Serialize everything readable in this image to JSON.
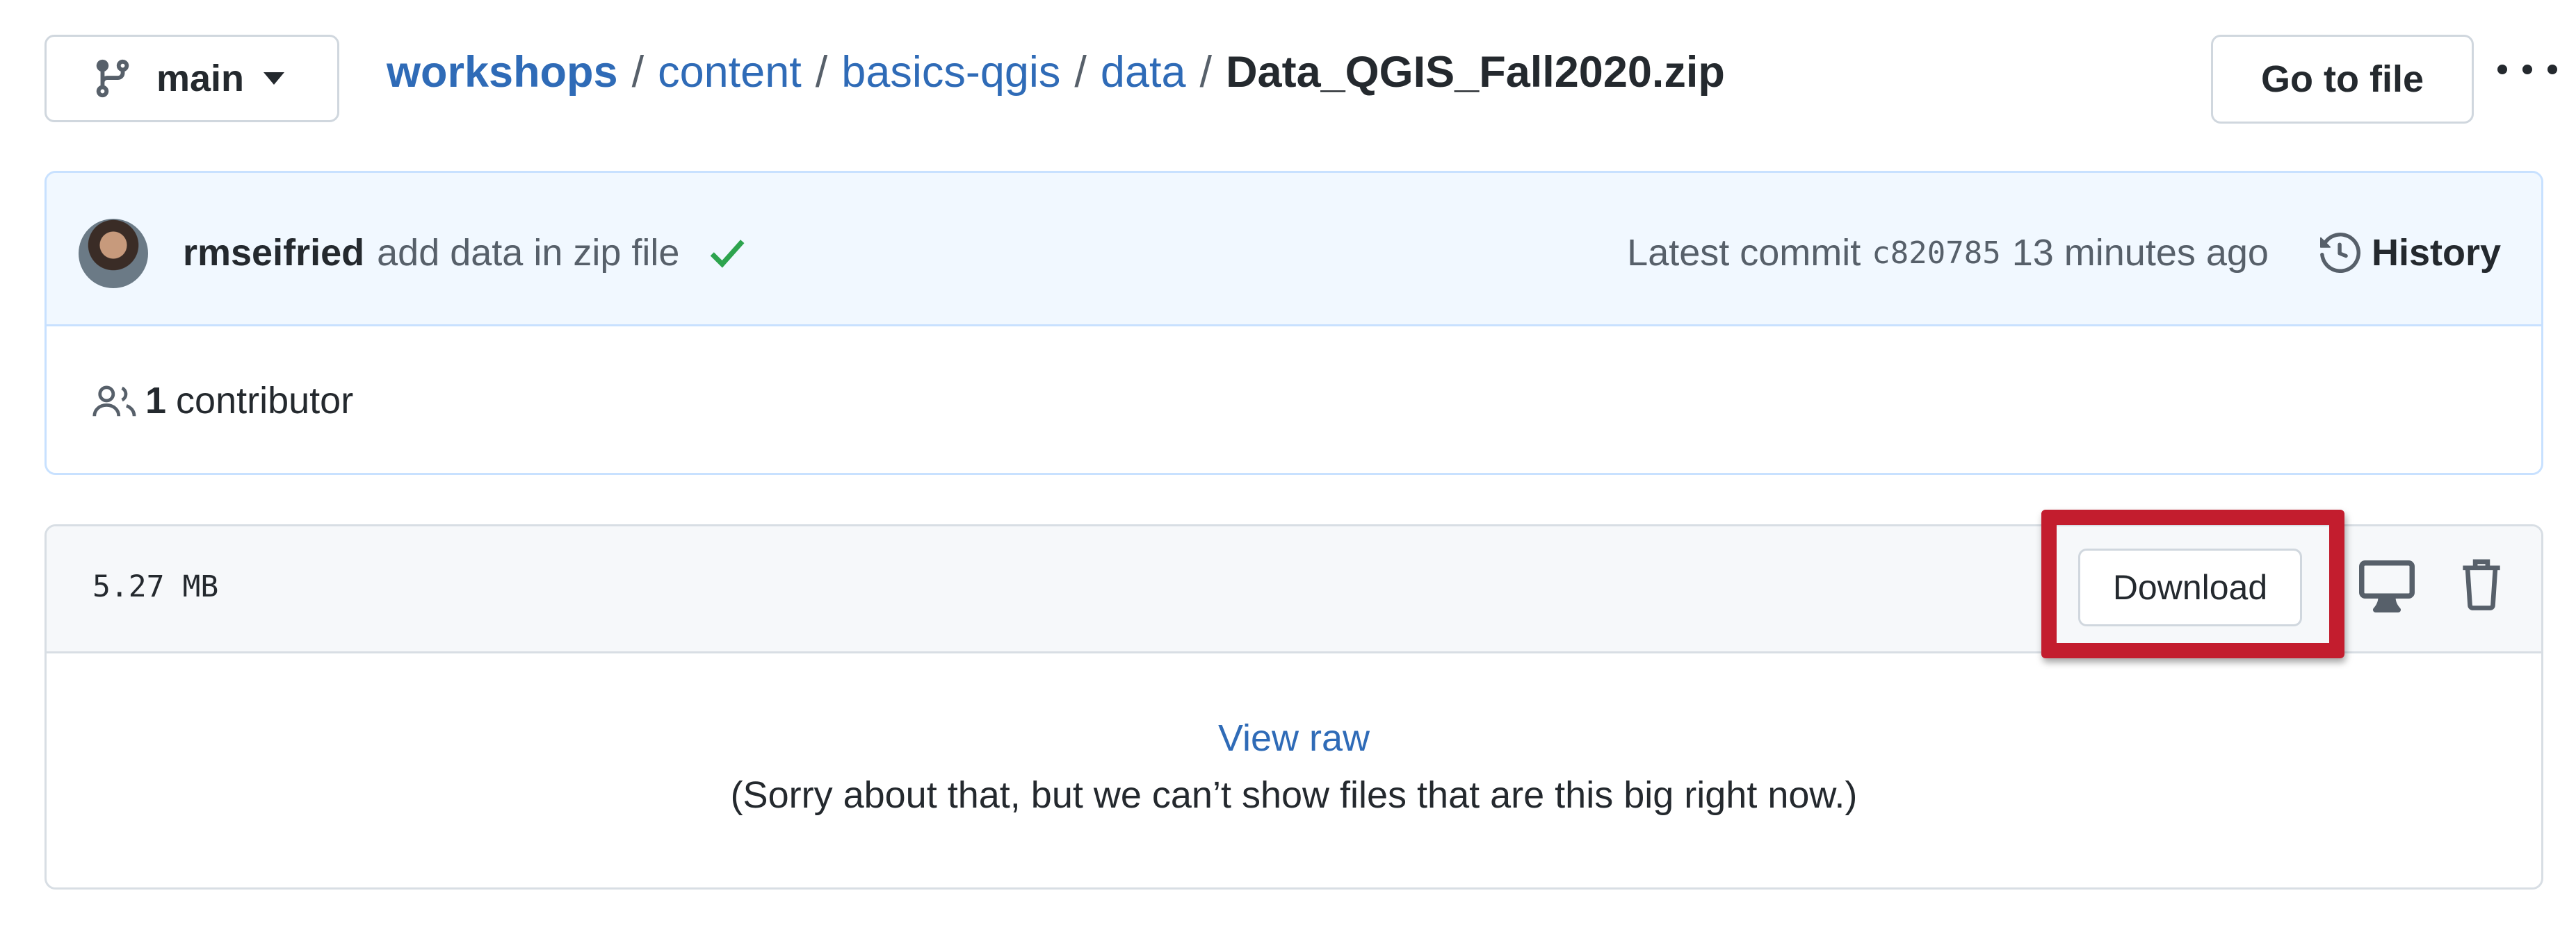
{
  "branch": {
    "label": "main"
  },
  "breadcrumb": {
    "repo": "workshops",
    "path": [
      "content",
      "basics-qgis",
      "data"
    ],
    "separator": "/",
    "file": "Data_QGIS_Fall2020.zip"
  },
  "actions": {
    "go_to_file": "Go to file",
    "more_icon": "kebab-horizontal-icon"
  },
  "commit": {
    "author": "rmseifried",
    "message": "add data in zip file",
    "status_icon": "check-icon",
    "status_color": "#2da44e",
    "latest_label": "Latest commit",
    "sha": "c820785",
    "time": "13 minutes ago",
    "history_label": "History"
  },
  "contributors": {
    "count": "1",
    "label": "contributor"
  },
  "file": {
    "size": "5.27 MB",
    "download_label": "Download",
    "view_raw": "View raw",
    "too_big_message": "(Sorry about that, but we can’t show files that are this big right now.)"
  },
  "colors": {
    "link": "#2f6bb7",
    "highlight": "#c31d2e",
    "commit_bg": "#f1f8ff"
  }
}
